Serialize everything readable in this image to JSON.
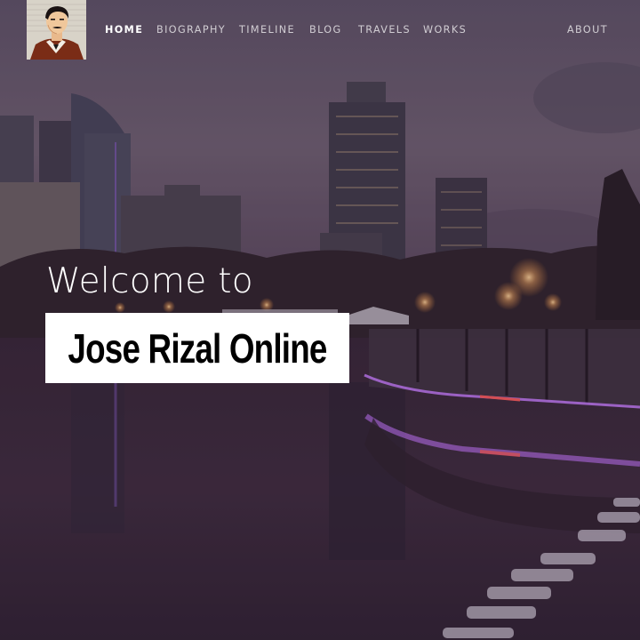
{
  "nav": {
    "logo_alt": "Jose Rizal portrait logo",
    "items": [
      {
        "label": "HOME",
        "active": true
      },
      {
        "label": "BIOGRAPHY"
      },
      {
        "label": "TIMELINE"
      },
      {
        "label": "BLOG"
      },
      {
        "label": "TRAVELS"
      },
      {
        "label": "WORKS"
      }
    ],
    "about_label": "ABOUT"
  },
  "hero": {
    "welcome": "Welcome to",
    "title": "Jose Rizal Online",
    "background": "city skyline at dusk reflected on a river with purple neon railing lights"
  },
  "colors": {
    "nav_text": "#ffffff",
    "title_bg": "#ffffff",
    "title_text": "#000000",
    "neon": "#c77dff"
  }
}
